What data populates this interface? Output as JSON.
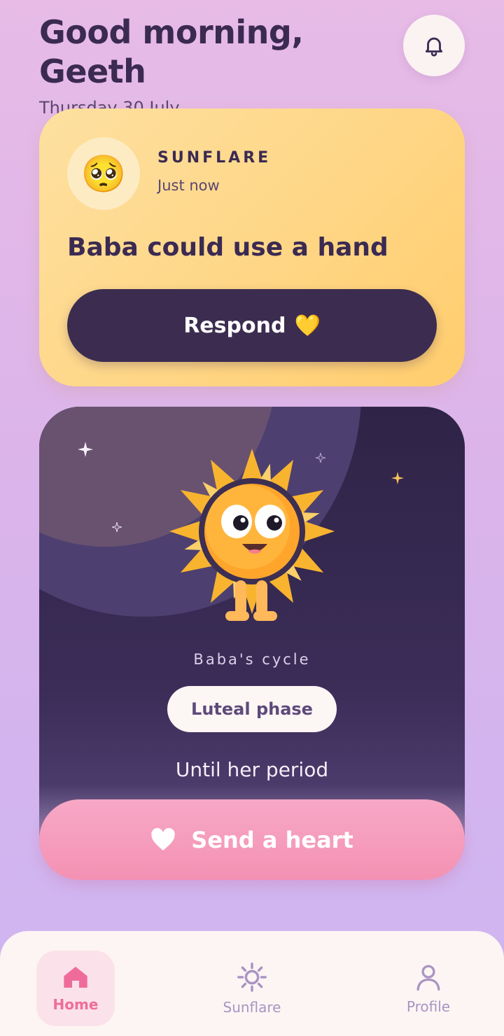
{
  "header": {
    "greeting": "Good morning, Geeth",
    "date": "Thursday 30 July"
  },
  "icons": {
    "bell": "bell-icon",
    "home": "home-icon",
    "sunflare": "sun-icon",
    "profile": "person-icon",
    "heart": "heart-icon"
  },
  "alert": {
    "emoji": "🥺",
    "sender": "SUNFLARE",
    "time": "Just now",
    "message": "Baba could use a hand",
    "respond_label": "Respond",
    "respond_emoji": "💛"
  },
  "cycle": {
    "label": "Baba's cycle",
    "phase": "Luteal phase",
    "until": "Until her period"
  },
  "send_heart_label": "Send a heart",
  "nav": {
    "home": "Home",
    "sunflare": "Sunflare",
    "profile": "Profile"
  },
  "colors": {
    "primary_dark": "#3c2d50",
    "accent_pink": "#f491b3",
    "card_yellow": "#ffd583",
    "active_nav": "#ef6c9a"
  }
}
